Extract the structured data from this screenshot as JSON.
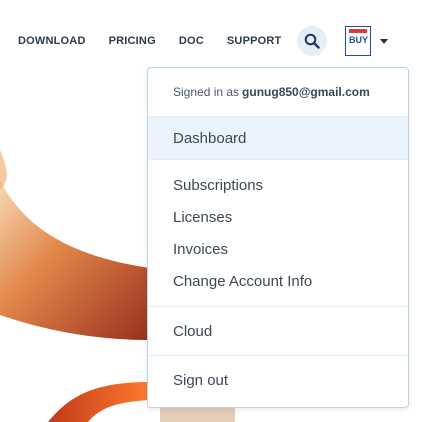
{
  "nav": {
    "links": [
      "DOWNLOAD",
      "PRICING",
      "DOC",
      "SUPPORT"
    ],
    "avatar_text": "BUY"
  },
  "dropdown": {
    "signed_prefix": "Signed in as",
    "email": "gunug850@gmail.com",
    "dashboard": "Dashboard",
    "account_items": [
      "Subscriptions",
      "Licenses",
      "Invoices",
      "Change Account Info"
    ],
    "cloud": "Cloud",
    "signout": "Sign out"
  },
  "colors": {
    "highlight": "#eaf3fb",
    "border": "#b8d6e8",
    "search_bg": "#e4eef7"
  }
}
